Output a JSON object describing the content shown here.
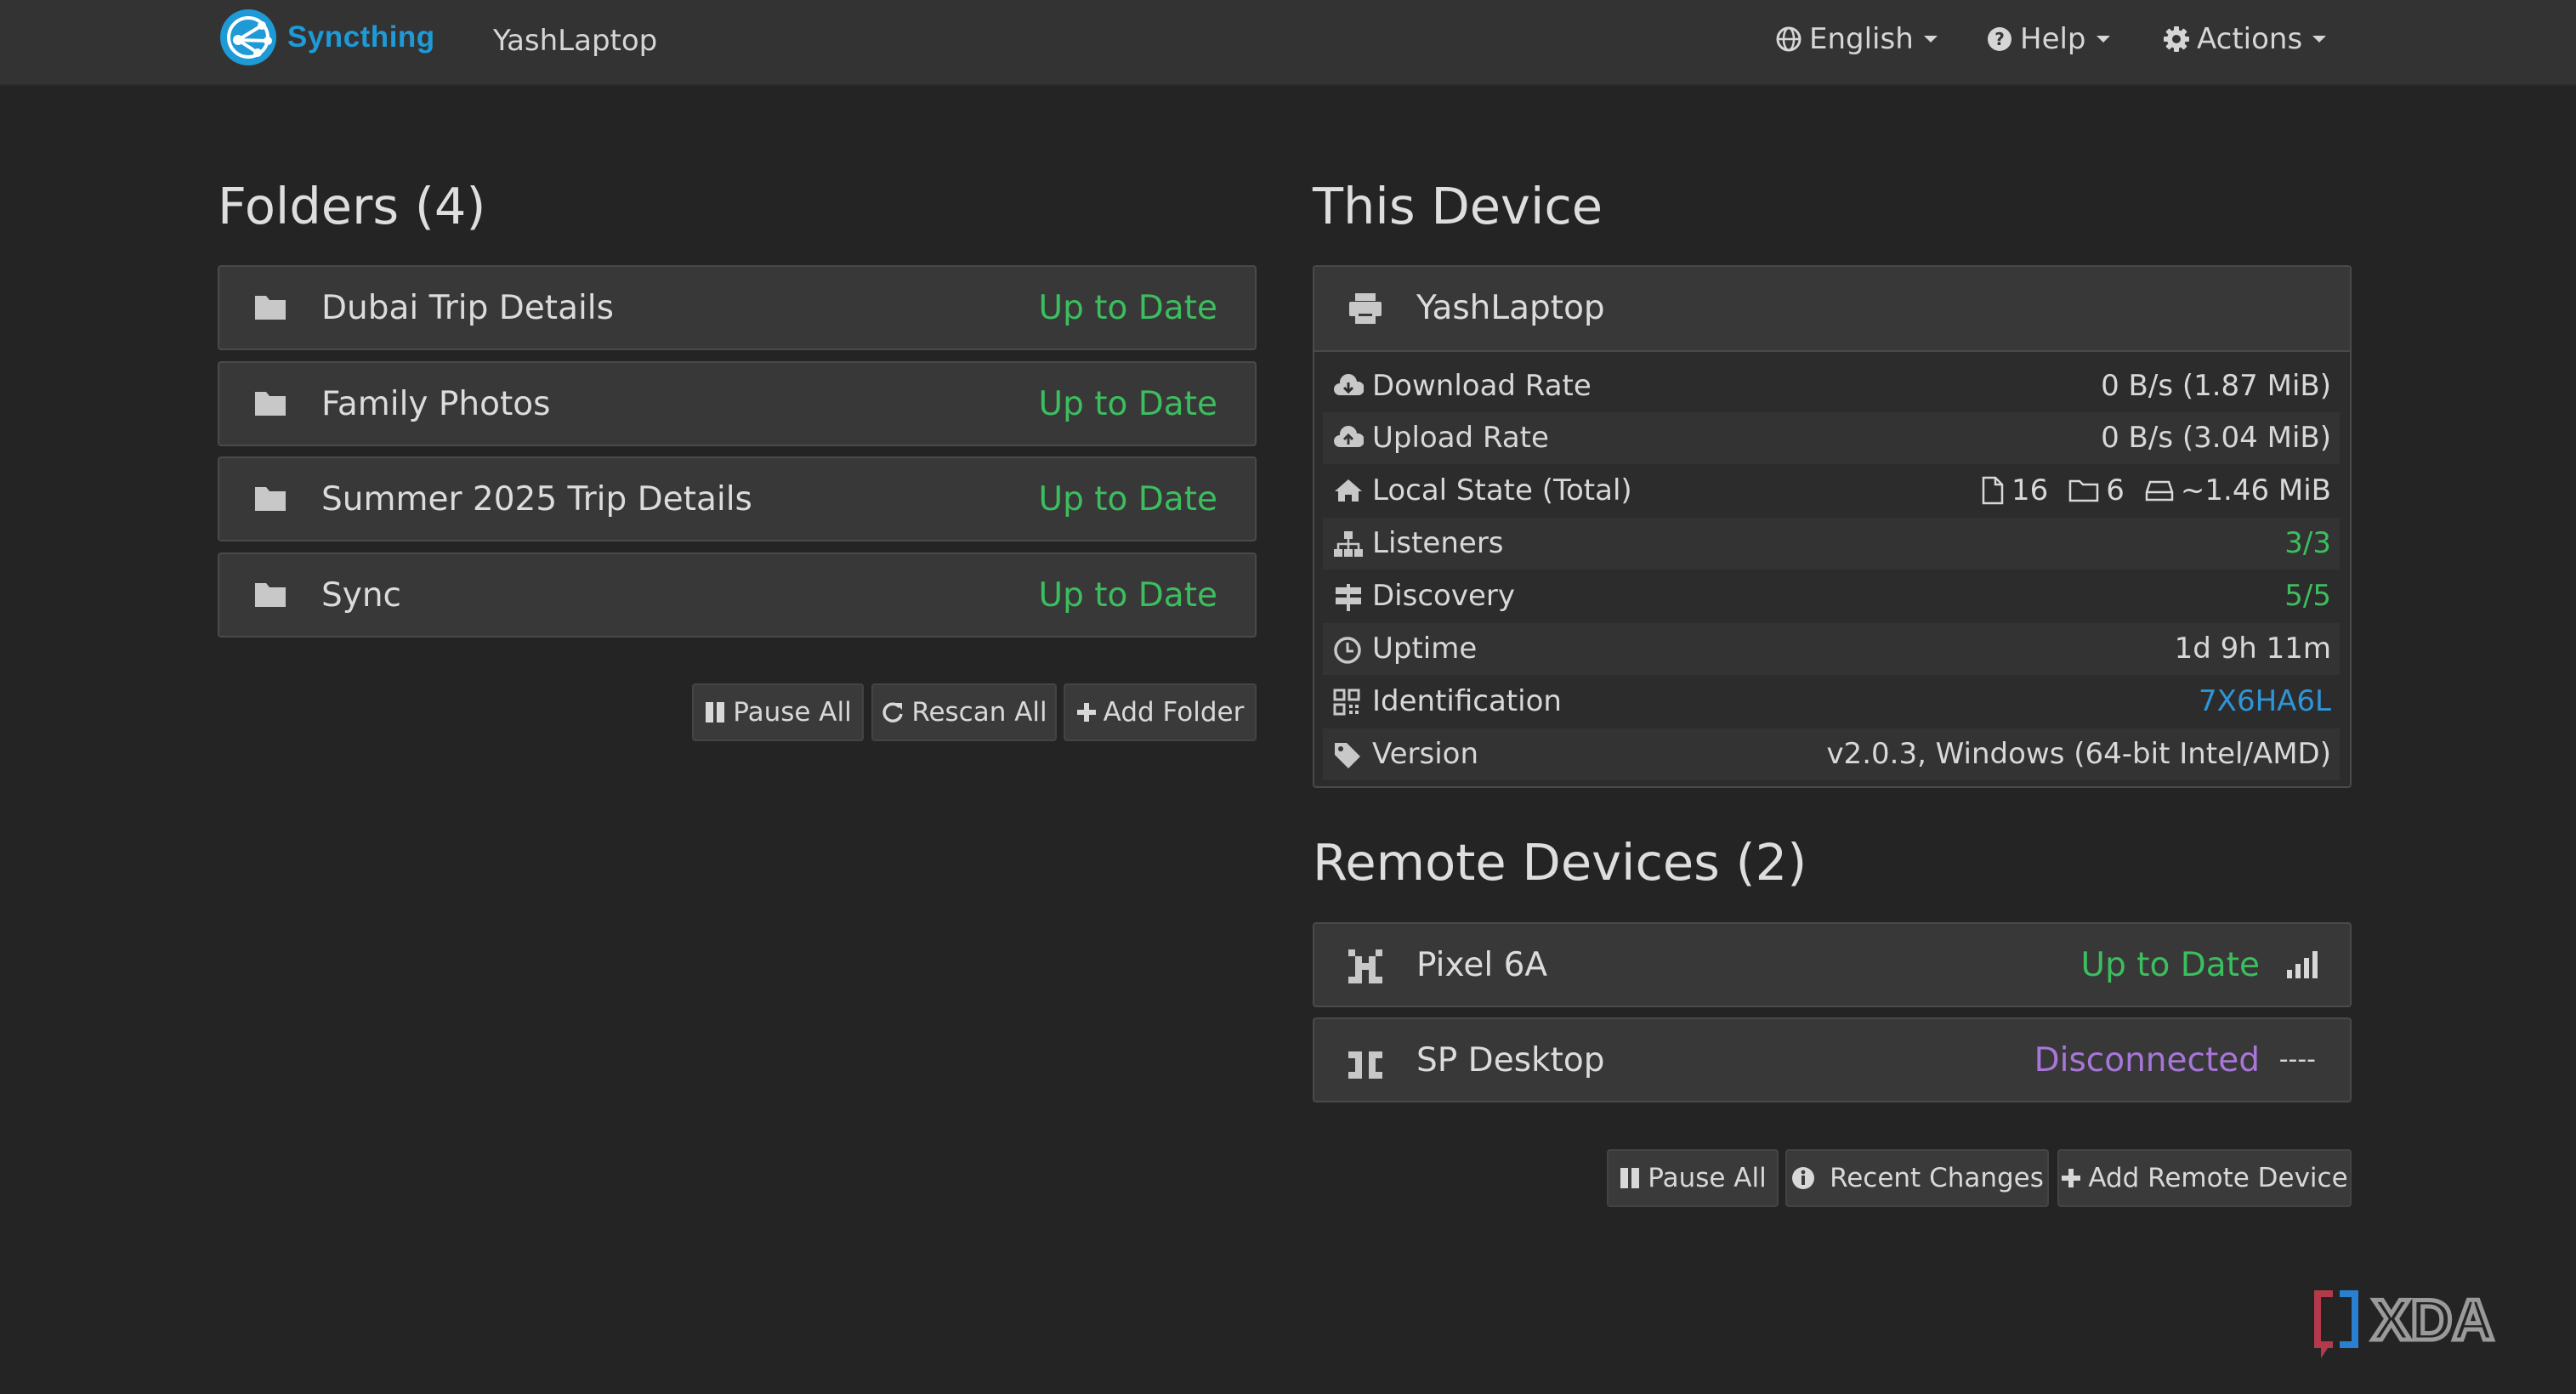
{
  "navbar": {
    "brand": "Syncthing",
    "device_name": "YashLaptop",
    "language": "English",
    "help": "Help",
    "actions": "Actions"
  },
  "folders": {
    "title": "Folders (4)",
    "items": [
      {
        "name": "Dubai Trip Details",
        "status": "Up to Date"
      },
      {
        "name": "Family Photos",
        "status": "Up to Date"
      },
      {
        "name": "Summer 2025 Trip Details",
        "status": "Up to Date"
      },
      {
        "name": "Sync",
        "status": "Up to Date"
      }
    ],
    "buttons": {
      "pause_all": "Pause All",
      "rescan_all": "Rescan All",
      "add_folder": "Add Folder"
    }
  },
  "this_device": {
    "title": "This Device",
    "name": "YashLaptop",
    "rows": {
      "download_rate": {
        "label": "Download Rate",
        "value": "0 B/s (1.87 MiB)"
      },
      "upload_rate": {
        "label": "Upload Rate",
        "value": "0 B/s (3.04 MiB)"
      },
      "local_state": {
        "label": "Local State (Total)",
        "files": "16",
        "dirs": "6",
        "size": "~1.46 MiB"
      },
      "listeners": {
        "label": "Listeners",
        "value": "3/3"
      },
      "discovery": {
        "label": "Discovery",
        "value": "5/5"
      },
      "uptime": {
        "label": "Uptime",
        "value": "1d 9h 11m"
      },
      "identification": {
        "label": "Identification",
        "value": "7X6HA6L"
      },
      "version": {
        "label": "Version",
        "value": "v2.0.3, Windows (64-bit Intel/AMD)"
      }
    }
  },
  "remote_devices": {
    "title": "Remote Devices (2)",
    "items": [
      {
        "name": "Pixel 6A",
        "status": "Up to Date"
      },
      {
        "name": "SP Desktop",
        "status": "Disconnected",
        "signal": "----"
      }
    ],
    "buttons": {
      "pause_all": "Pause All",
      "recent_changes": "Recent Changes",
      "add_remote_device": "Add Remote Device"
    }
  },
  "colors": {
    "accent": "#1e9ad6",
    "status_ok": "#3cbe5f",
    "status_disconnected": "#a876d8",
    "link": "#2e95d8",
    "background": "#242424"
  },
  "watermark": "XDA"
}
